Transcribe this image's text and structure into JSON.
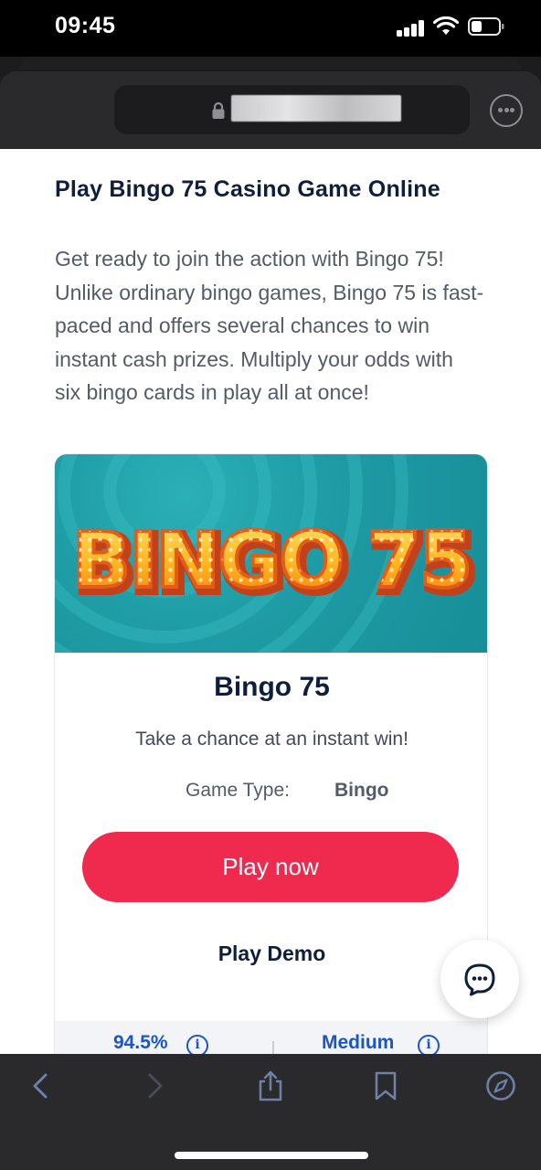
{
  "status_bar": {
    "time": "09:45"
  },
  "browser": {
    "url": ""
  },
  "content": {
    "title": "Play Bingo 75 Casino Game Online",
    "intro": "Get ready to join the action with Bingo 75! Unlike ordinary bingo games, Bingo 75 is fast-paced and offers several chances to win instant cash prizes. Multiply your odds with six bingo cards in play all at once!",
    "game": {
      "banner_logo_text": "BINGO 75",
      "name": "Bingo 75",
      "tagline": "Take a chance at an instant win!",
      "type_label": "Game Type:",
      "type_value": "Bingo",
      "play_now": "Play now",
      "play_demo": "Play Demo",
      "stats": {
        "rtp": "94.5%",
        "volatility": "Medium"
      }
    }
  },
  "colors": {
    "accent": "#f0294f",
    "heading": "#0f1f3a",
    "link": "#1c55c4",
    "banner_teal": "#1f9ca5"
  }
}
